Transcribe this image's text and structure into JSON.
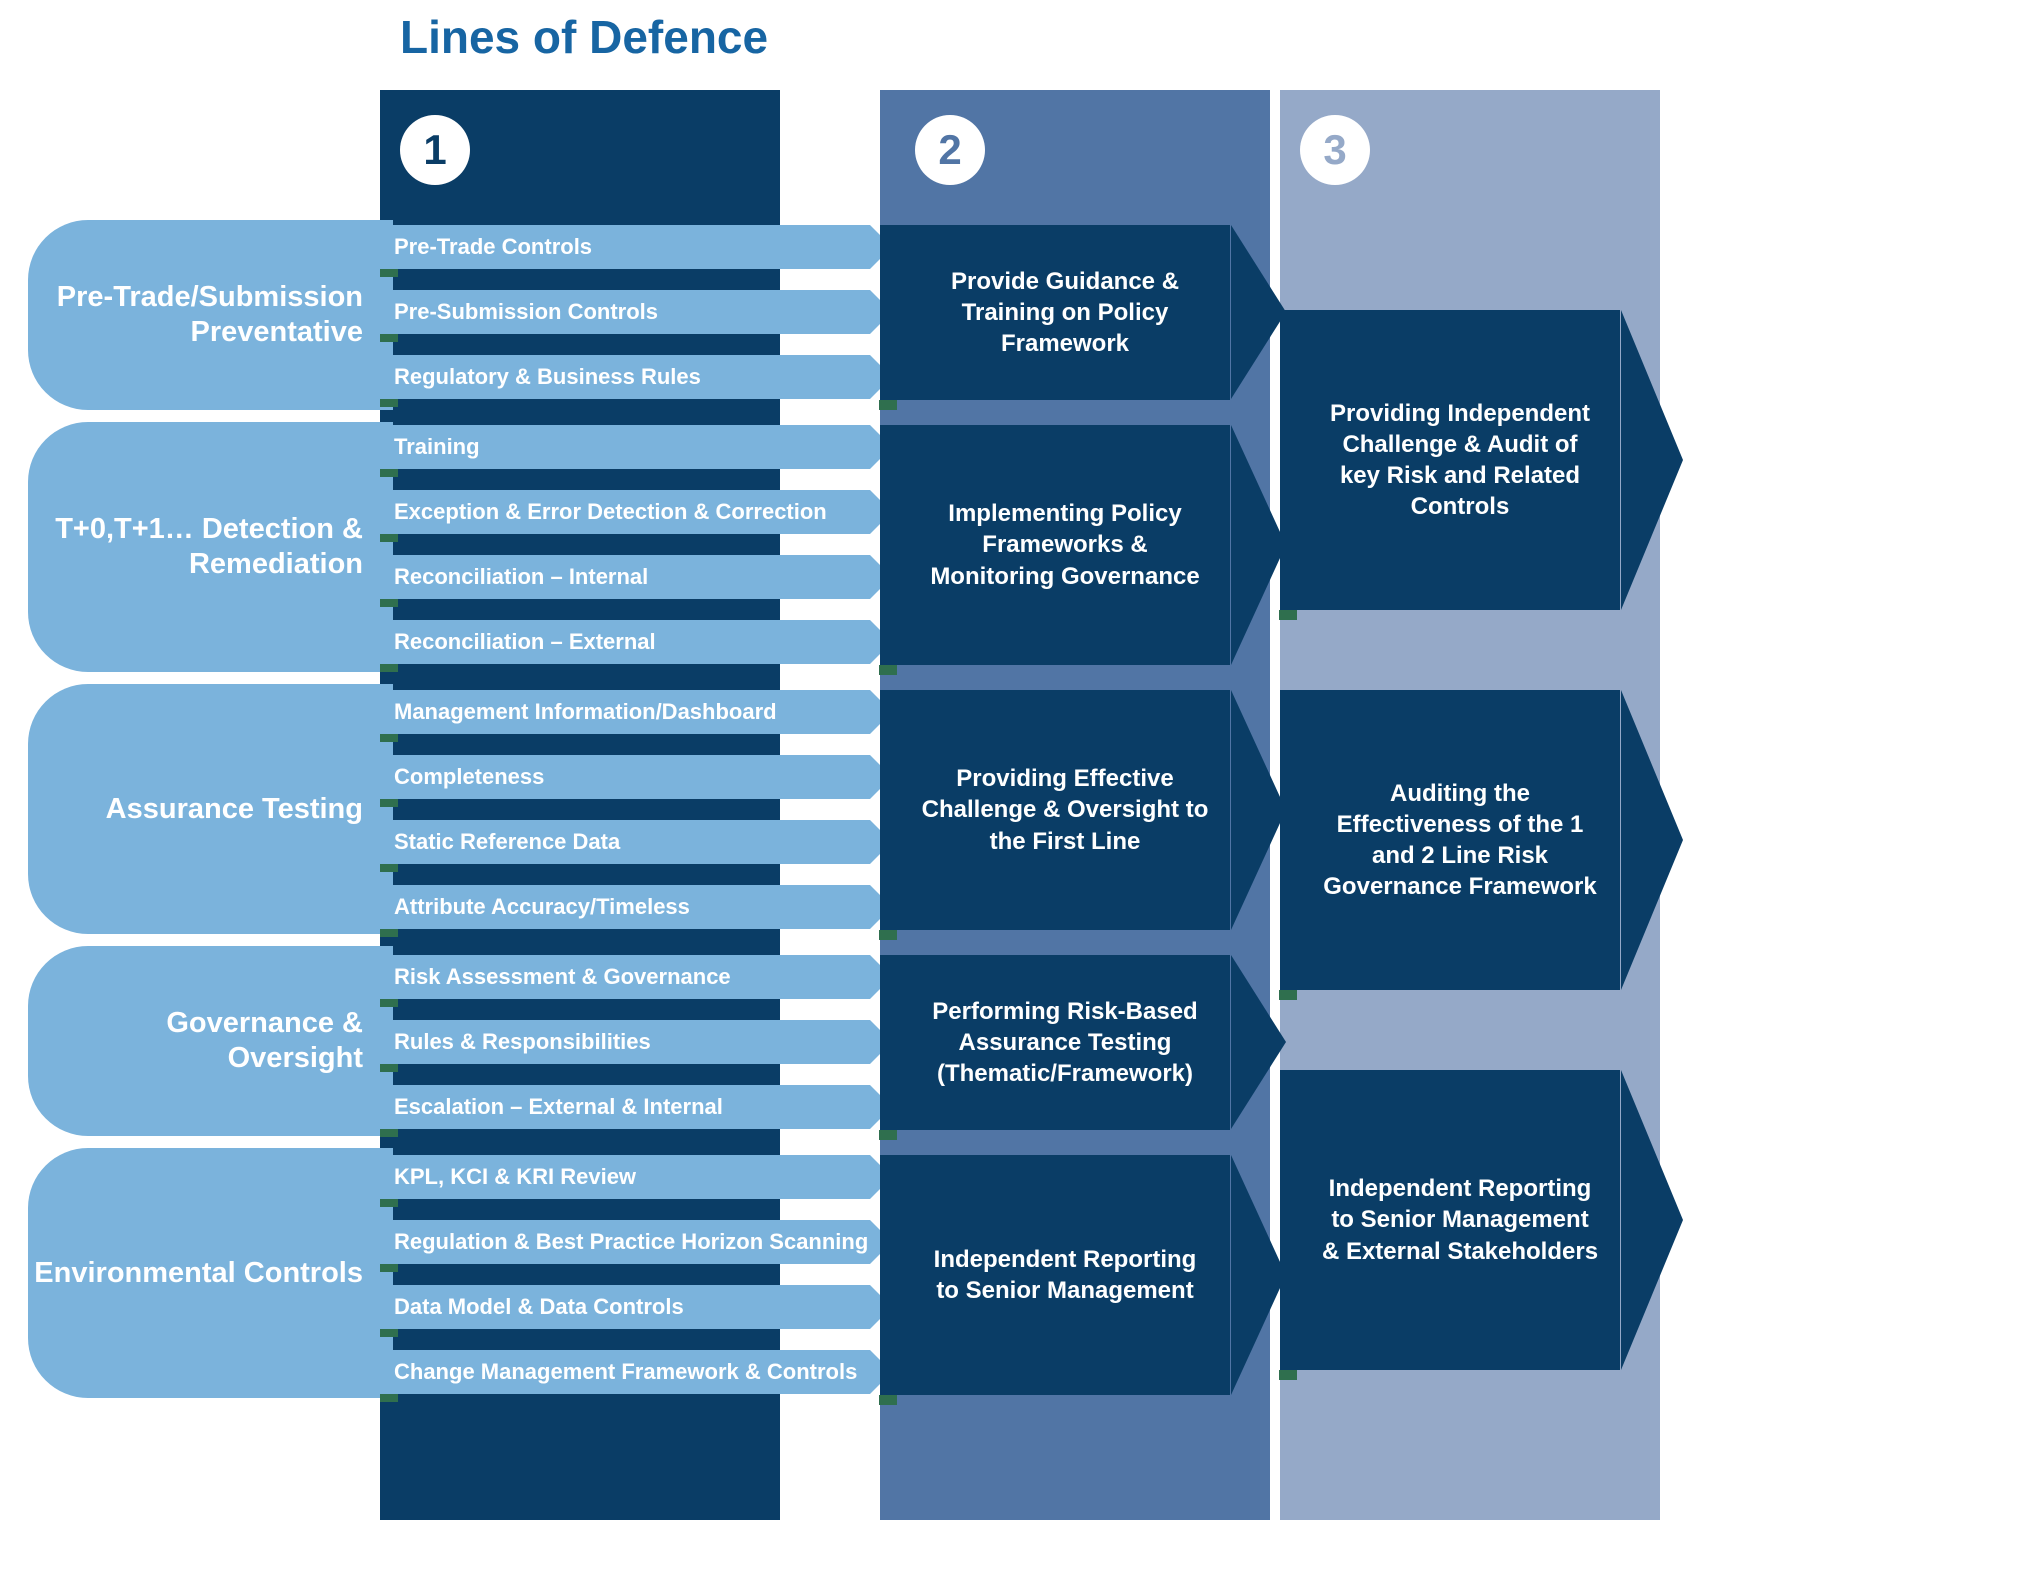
{
  "title": "Lines of Defence",
  "badges": {
    "one": "1",
    "two": "2",
    "three": "3"
  },
  "categories": [
    {
      "label": "Pre-Trade/Submission Preventative"
    },
    {
      "label": "T+0,T+1… Detection & Remediation"
    },
    {
      "label": "Assurance Testing"
    },
    {
      "label": "Governance & Oversight"
    },
    {
      "label": "Environmental Controls"
    }
  ],
  "col1_items": [
    "Pre-Trade Controls",
    "Pre-Submission Controls",
    "Regulatory & Business Rules",
    "Training",
    "Exception & Error Detection & Correction",
    "Reconciliation – Internal",
    "Reconciliation – External",
    "Management Information/Dashboard",
    "Completeness",
    "Static Reference Data",
    "Attribute Accuracy/Timeless",
    "Risk Assessment & Governance",
    "Rules & Responsibilities",
    "Escalation – External & Internal",
    "KPL, KCI & KRI Review",
    "Regulation & Best Practice Horizon Scanning",
    "Data Model & Data Controls",
    "Change Management Framework & Controls"
  ],
  "col2_items": [
    "Provide Guidance & Training on Policy Framework",
    "Implementing Policy Frameworks & Monitoring Governance",
    "Providing Effective Challenge & Oversight to the First Line",
    "Performing Risk-Based Assurance Testing (Thematic/Framework)",
    "Independent Reporting to Senior Management"
  ],
  "col3_items": [
    "Providing Independent Challenge & Audit of key Risk and Related Controls",
    "Auditing the Effectiveness of the 1 and 2 Line Risk Governance Framework",
    "Independent Reporting to Senior Management & External Stakeholders"
  ]
}
